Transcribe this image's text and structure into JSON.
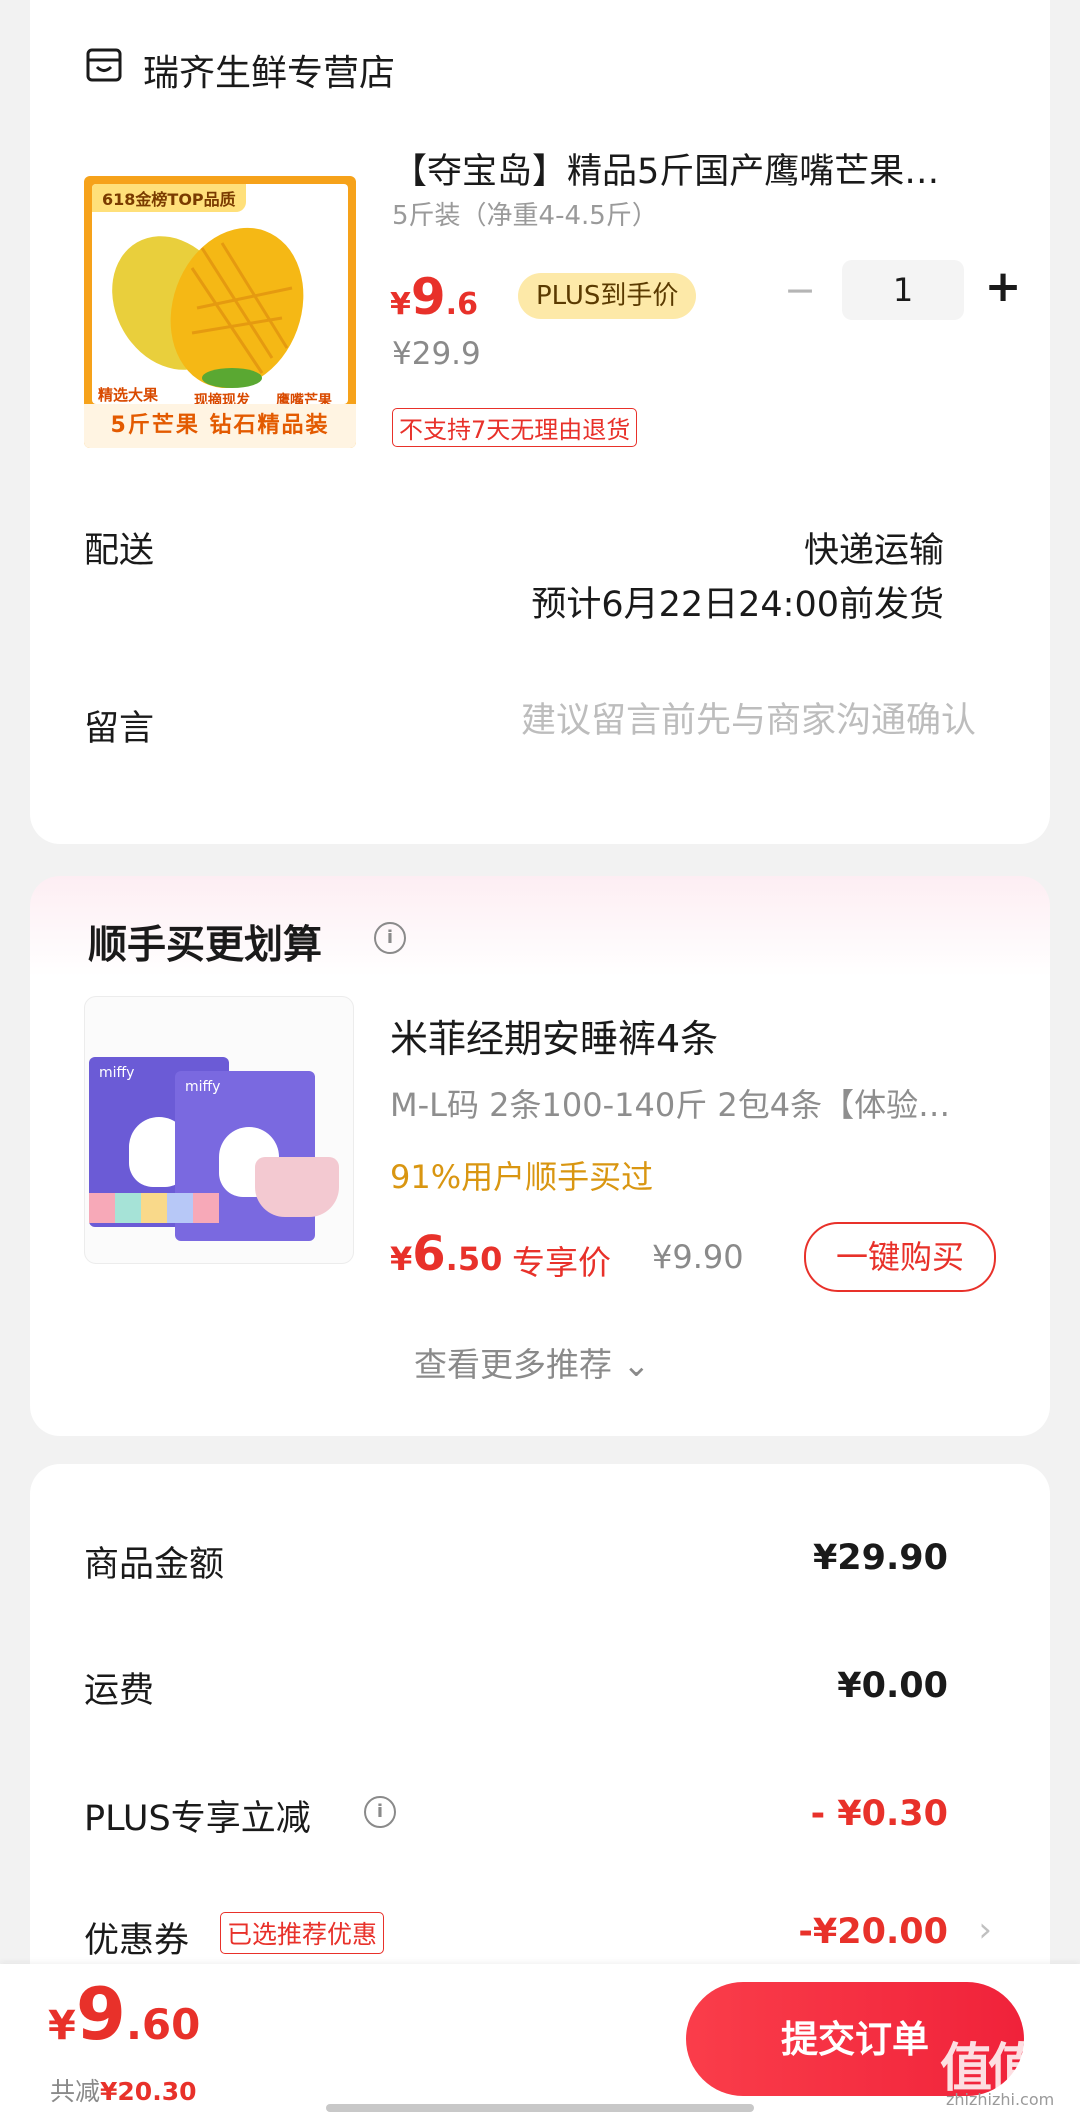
{
  "shop": {
    "name": "瑞齐生鲜专营店",
    "icon": "shop-icon"
  },
  "product": {
    "image": {
      "badge": "618金榜TOP品质",
      "tag_a": "精选大果",
      "tag_b": "现摘现发",
      "tag_c": "鹰嘴芒果",
      "bottom": "5斤芒果  钻石精品装"
    },
    "title": "【夺宝岛】精品5斤国产鹰嘴芒果…",
    "spec": "5斤装（净重4-4.5斤）",
    "price_symbol": "¥",
    "price_int": "9",
    "price_dec": ".6",
    "plus_tag": "PLUS到手价",
    "original_price": "¥29.9",
    "return_notice": "不支持7天无理由退货",
    "quantity": "1",
    "minus": "−",
    "plus": "+"
  },
  "delivery": {
    "label": "配送",
    "method": "快递运输",
    "eta": "预计6月22日24:00前发货"
  },
  "message": {
    "label": "留言",
    "placeholder": "建议留言前先与商家沟通确认"
  },
  "recommend": {
    "title": "顺手买更划算",
    "info_icon": "info-icon",
    "item": {
      "image_brand": "miffy",
      "name": "米菲经期安睡裤4条",
      "spec": "M-L码 2条100-140斤   2包4条【体验…",
      "bought": "91%用户顺手买过",
      "price_symbol": "¥",
      "price_int": "6",
      "price_dec": ".50",
      "exclusive": "专享价",
      "original_price": "¥9.90",
      "buy_button": "一键购买"
    },
    "more": "查看更多推荐 ⌄"
  },
  "summary": {
    "goods_label": "商品金额",
    "goods_value": "¥29.90",
    "shipping_label": "运费",
    "shipping_value": "¥0.00",
    "plus_label": "PLUS专享立减",
    "plus_value": "- ¥0.30",
    "coupon_label": "优惠券",
    "coupon_tag": "已选推荐优惠",
    "coupon_value": "-¥20.00",
    "chevron": "›"
  },
  "bottom_bar": {
    "price_symbol": "¥",
    "price_int": "9",
    "price_dec": ".60",
    "saved_label": "共减",
    "saved_amount": "¥20.30",
    "submit": "提交订单",
    "watermark": "值值值",
    "watermark_sub": "zhizhizhi.com"
  },
  "colors": {
    "accent": "#e8312a",
    "plus_tag_bg": "#fde9a8",
    "bought": "#d99611"
  }
}
